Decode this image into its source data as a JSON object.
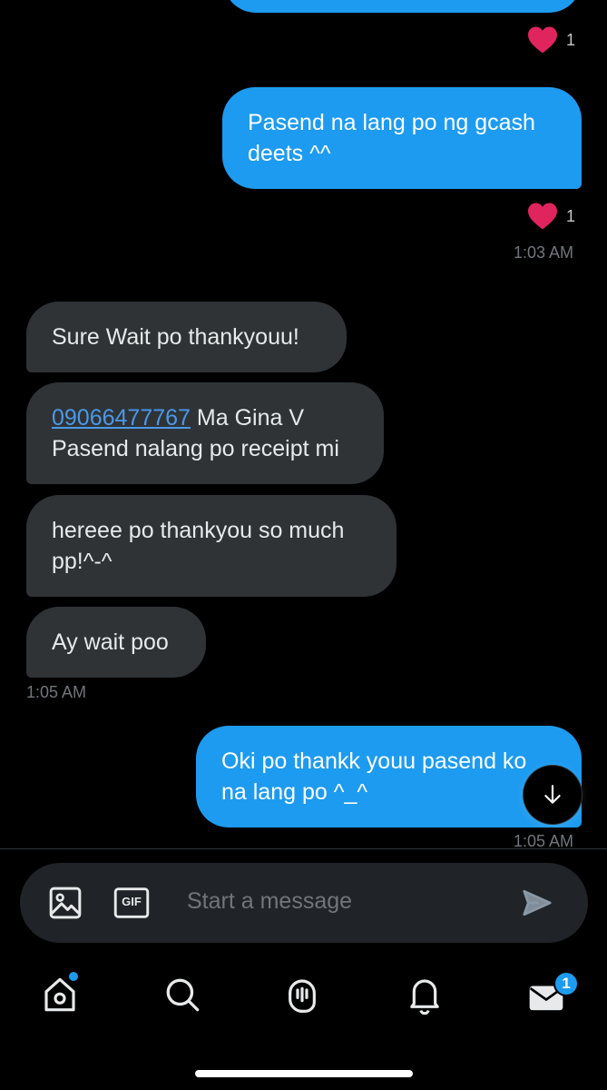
{
  "conversation": {
    "messages": [
      {
        "direction": "out",
        "text": "Pasend na lang po ng gcash\ndeets ^^"
      },
      {
        "direction": "in",
        "text": "Sure Wait po thankyouu!"
      },
      {
        "direction": "in",
        "link": "09066477767",
        "text": " Ma Gina V\nPasend nalang po receipt mi"
      },
      {
        "direction": "in",
        "text": "hereee po thankyou so much\npp!^-^"
      },
      {
        "direction": "in",
        "text": "Ay wait poo"
      },
      {
        "direction": "out",
        "text": "Oki po thankk youu pasend ko\nna lang po ^_^"
      }
    ],
    "reactions": [
      {
        "icon": "heart-icon",
        "count": "1"
      },
      {
        "icon": "heart-icon",
        "count": "1"
      }
    ],
    "timestamps": [
      "1:03 AM",
      "1:05 AM",
      "1:05 AM"
    ]
  },
  "composer": {
    "placeholder": "Start a message",
    "media_icon": "image-icon",
    "gif_label": "GIF",
    "send_icon": "send-icon"
  },
  "scroll_down_icon": "arrow-down-icon",
  "bottom_nav": {
    "items": [
      {
        "icon": "home-icon",
        "has_dot": true
      },
      {
        "icon": "search-icon"
      },
      {
        "icon": "spaces-icon"
      },
      {
        "icon": "bell-icon"
      },
      {
        "icon": "mail-icon",
        "badge": "1"
      }
    ]
  },
  "colors": {
    "background": "#000000",
    "outgoing_bubble": "#1d9bf0",
    "incoming_bubble": "#2f3336",
    "link": "#4a99e9",
    "heart": "#e0245e",
    "muted_text": "#71767b"
  }
}
